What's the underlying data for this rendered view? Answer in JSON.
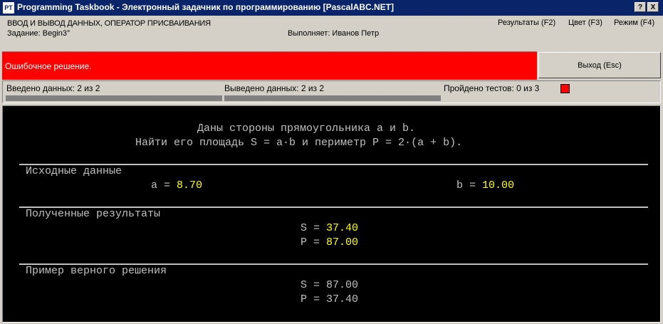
{
  "window": {
    "app_icon": "PT",
    "title": "Programming Taskbook - Электронный задачник по программированию [PascalABC.NET]",
    "help_button": "?",
    "close_button": "X"
  },
  "header": {
    "group_title": "ВВОД И ВЫВОД ДАННЫХ, ОПЕРАТОР ПРИСВАИВАНИЯ",
    "task": "Задание: Begin3°",
    "performer": "Выполняет: Иванов Петр",
    "menu": {
      "results": "Результаты (F2)",
      "color": "Цвет (F3)",
      "mode": "Режим (F4)"
    }
  },
  "status": {
    "message": "Ошибочное решение.",
    "exit_button": "Выход (Esc)",
    "colors": {
      "error_bg": "#ff0000",
      "console_bg": "#000000",
      "value": "#ffff00",
      "text": "#c0c0c0"
    }
  },
  "progress": {
    "input_label": "Введено данных:",
    "input_value": "2 из 2",
    "input_fraction": 1.0,
    "output_label": "Выведено данных:",
    "output_value": "2 из 2",
    "output_fraction": 1.0,
    "tests_label": "Пройдено тестов:",
    "tests_value": "0 из 3"
  },
  "task_text": {
    "line1": "Даны стороны прямоугольника a и b.",
    "line2": "Найти его площадь S = a·b и периметр P = 2·(a + b)."
  },
  "sections": {
    "input": {
      "title": "Исходные данные",
      "a_label": "a = ",
      "a_value": "8.70",
      "b_label": "b = ",
      "b_value": "10.00"
    },
    "results": {
      "title": "Полученные результаты",
      "s_label": "S = ",
      "s_value": "37.40",
      "p_label": "P = ",
      "p_value": "87.00"
    },
    "example": {
      "title": "Пример верного решения",
      "s_line": "S = 87.00",
      "p_line": "P = 37.40"
    }
  }
}
